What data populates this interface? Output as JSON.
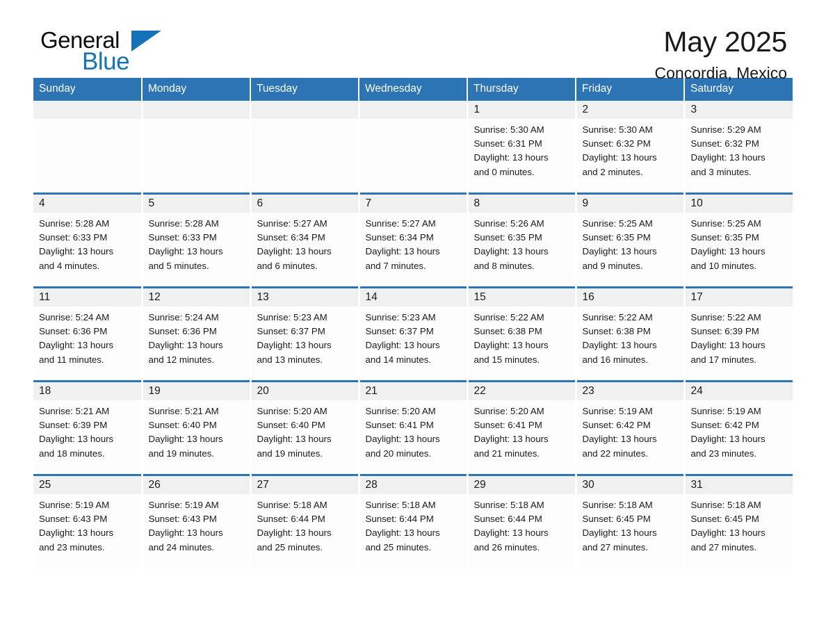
{
  "brand": {
    "name_part1": "General",
    "name_part2": "Blue",
    "triangle_icon": "triangle-icon",
    "accent_color": "#1473b8"
  },
  "header": {
    "month_title": "May 2025",
    "location": "Concordia, Mexico"
  },
  "theme": {
    "header_blue": "#2c74b3",
    "date_band_gray": "#f0f0f0",
    "cell_white": "#fdfdfd",
    "text_dark": "#1a1a1a"
  },
  "calendar": {
    "weekday_headers": [
      "Sunday",
      "Monday",
      "Tuesday",
      "Wednesday",
      "Thursday",
      "Friday",
      "Saturday"
    ],
    "weeks": [
      [
        {
          "date": "",
          "empty": true
        },
        {
          "date": "",
          "empty": true
        },
        {
          "date": "",
          "empty": true
        },
        {
          "date": "",
          "empty": true
        },
        {
          "date": "1",
          "sunrise": "Sunrise: 5:30 AM",
          "sunset": "Sunset: 6:31 PM",
          "daylight_line1": "Daylight: 13 hours",
          "daylight_line2": "and 0 minutes."
        },
        {
          "date": "2",
          "sunrise": "Sunrise: 5:30 AM",
          "sunset": "Sunset: 6:32 PM",
          "daylight_line1": "Daylight: 13 hours",
          "daylight_line2": "and 2 minutes."
        },
        {
          "date": "3",
          "sunrise": "Sunrise: 5:29 AM",
          "sunset": "Sunset: 6:32 PM",
          "daylight_line1": "Daylight: 13 hours",
          "daylight_line2": "and 3 minutes."
        }
      ],
      [
        {
          "date": "4",
          "sunrise": "Sunrise: 5:28 AM",
          "sunset": "Sunset: 6:33 PM",
          "daylight_line1": "Daylight: 13 hours",
          "daylight_line2": "and 4 minutes."
        },
        {
          "date": "5",
          "sunrise": "Sunrise: 5:28 AM",
          "sunset": "Sunset: 6:33 PM",
          "daylight_line1": "Daylight: 13 hours",
          "daylight_line2": "and 5 minutes."
        },
        {
          "date": "6",
          "sunrise": "Sunrise: 5:27 AM",
          "sunset": "Sunset: 6:34 PM",
          "daylight_line1": "Daylight: 13 hours",
          "daylight_line2": "and 6 minutes."
        },
        {
          "date": "7",
          "sunrise": "Sunrise: 5:27 AM",
          "sunset": "Sunset: 6:34 PM",
          "daylight_line1": "Daylight: 13 hours",
          "daylight_line2": "and 7 minutes."
        },
        {
          "date": "8",
          "sunrise": "Sunrise: 5:26 AM",
          "sunset": "Sunset: 6:35 PM",
          "daylight_line1": "Daylight: 13 hours",
          "daylight_line2": "and 8 minutes."
        },
        {
          "date": "9",
          "sunrise": "Sunrise: 5:25 AM",
          "sunset": "Sunset: 6:35 PM",
          "daylight_line1": "Daylight: 13 hours",
          "daylight_line2": "and 9 minutes."
        },
        {
          "date": "10",
          "sunrise": "Sunrise: 5:25 AM",
          "sunset": "Sunset: 6:35 PM",
          "daylight_line1": "Daylight: 13 hours",
          "daylight_line2": "and 10 minutes."
        }
      ],
      [
        {
          "date": "11",
          "sunrise": "Sunrise: 5:24 AM",
          "sunset": "Sunset: 6:36 PM",
          "daylight_line1": "Daylight: 13 hours",
          "daylight_line2": "and 11 minutes."
        },
        {
          "date": "12",
          "sunrise": "Sunrise: 5:24 AM",
          "sunset": "Sunset: 6:36 PM",
          "daylight_line1": "Daylight: 13 hours",
          "daylight_line2": "and 12 minutes."
        },
        {
          "date": "13",
          "sunrise": "Sunrise: 5:23 AM",
          "sunset": "Sunset: 6:37 PM",
          "daylight_line1": "Daylight: 13 hours",
          "daylight_line2": "and 13 minutes."
        },
        {
          "date": "14",
          "sunrise": "Sunrise: 5:23 AM",
          "sunset": "Sunset: 6:37 PM",
          "daylight_line1": "Daylight: 13 hours",
          "daylight_line2": "and 14 minutes."
        },
        {
          "date": "15",
          "sunrise": "Sunrise: 5:22 AM",
          "sunset": "Sunset: 6:38 PM",
          "daylight_line1": "Daylight: 13 hours",
          "daylight_line2": "and 15 minutes."
        },
        {
          "date": "16",
          "sunrise": "Sunrise: 5:22 AM",
          "sunset": "Sunset: 6:38 PM",
          "daylight_line1": "Daylight: 13 hours",
          "daylight_line2": "and 16 minutes."
        },
        {
          "date": "17",
          "sunrise": "Sunrise: 5:22 AM",
          "sunset": "Sunset: 6:39 PM",
          "daylight_line1": "Daylight: 13 hours",
          "daylight_line2": "and 17 minutes."
        }
      ],
      [
        {
          "date": "18",
          "sunrise": "Sunrise: 5:21 AM",
          "sunset": "Sunset: 6:39 PM",
          "daylight_line1": "Daylight: 13 hours",
          "daylight_line2": "and 18 minutes."
        },
        {
          "date": "19",
          "sunrise": "Sunrise: 5:21 AM",
          "sunset": "Sunset: 6:40 PM",
          "daylight_line1": "Daylight: 13 hours",
          "daylight_line2": "and 19 minutes."
        },
        {
          "date": "20",
          "sunrise": "Sunrise: 5:20 AM",
          "sunset": "Sunset: 6:40 PM",
          "daylight_line1": "Daylight: 13 hours",
          "daylight_line2": "and 19 minutes."
        },
        {
          "date": "21",
          "sunrise": "Sunrise: 5:20 AM",
          "sunset": "Sunset: 6:41 PM",
          "daylight_line1": "Daylight: 13 hours",
          "daylight_line2": "and 20 minutes."
        },
        {
          "date": "22",
          "sunrise": "Sunrise: 5:20 AM",
          "sunset": "Sunset: 6:41 PM",
          "daylight_line1": "Daylight: 13 hours",
          "daylight_line2": "and 21 minutes."
        },
        {
          "date": "23",
          "sunrise": "Sunrise: 5:19 AM",
          "sunset": "Sunset: 6:42 PM",
          "daylight_line1": "Daylight: 13 hours",
          "daylight_line2": "and 22 minutes."
        },
        {
          "date": "24",
          "sunrise": "Sunrise: 5:19 AM",
          "sunset": "Sunset: 6:42 PM",
          "daylight_line1": "Daylight: 13 hours",
          "daylight_line2": "and 23 minutes."
        }
      ],
      [
        {
          "date": "25",
          "sunrise": "Sunrise: 5:19 AM",
          "sunset": "Sunset: 6:43 PM",
          "daylight_line1": "Daylight: 13 hours",
          "daylight_line2": "and 23 minutes."
        },
        {
          "date": "26",
          "sunrise": "Sunrise: 5:19 AM",
          "sunset": "Sunset: 6:43 PM",
          "daylight_line1": "Daylight: 13 hours",
          "daylight_line2": "and 24 minutes."
        },
        {
          "date": "27",
          "sunrise": "Sunrise: 5:18 AM",
          "sunset": "Sunset: 6:44 PM",
          "daylight_line1": "Daylight: 13 hours",
          "daylight_line2": "and 25 minutes."
        },
        {
          "date": "28",
          "sunrise": "Sunrise: 5:18 AM",
          "sunset": "Sunset: 6:44 PM",
          "daylight_line1": "Daylight: 13 hours",
          "daylight_line2": "and 25 minutes."
        },
        {
          "date": "29",
          "sunrise": "Sunrise: 5:18 AM",
          "sunset": "Sunset: 6:44 PM",
          "daylight_line1": "Daylight: 13 hours",
          "daylight_line2": "and 26 minutes."
        },
        {
          "date": "30",
          "sunrise": "Sunrise: 5:18 AM",
          "sunset": "Sunset: 6:45 PM",
          "daylight_line1": "Daylight: 13 hours",
          "daylight_line2": "and 27 minutes."
        },
        {
          "date": "31",
          "sunrise": "Sunrise: 5:18 AM",
          "sunset": "Sunset: 6:45 PM",
          "daylight_line1": "Daylight: 13 hours",
          "daylight_line2": "and 27 minutes."
        }
      ]
    ]
  }
}
